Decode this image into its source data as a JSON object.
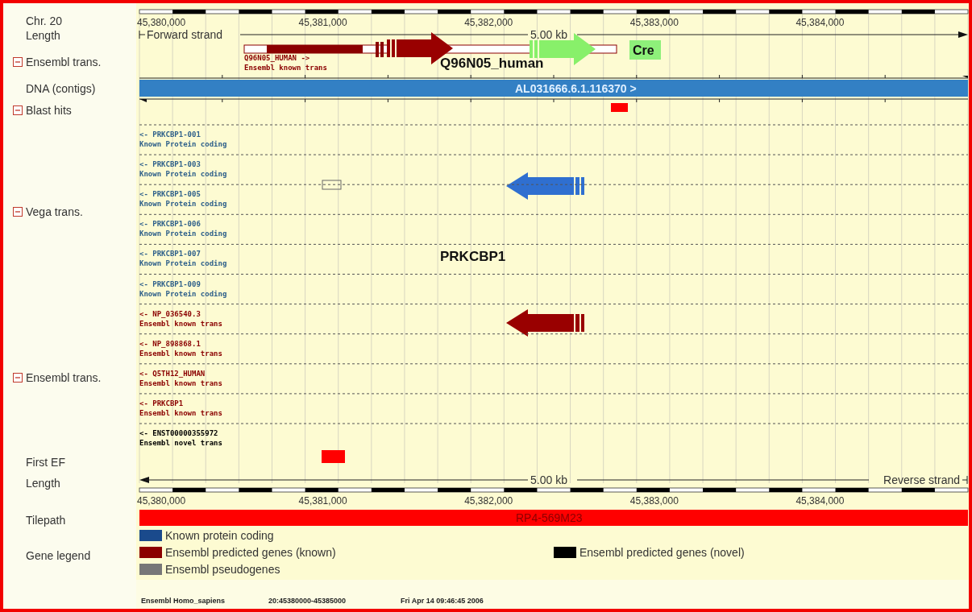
{
  "header": {
    "chromosome": "Chr. 20",
    "length_label": "Length"
  },
  "ruler_top": {
    "ticks": [
      "45,380,000",
      "45,381,000",
      "45,382,000",
      "45,383,000",
      "45,384,000"
    ],
    "strand": "Forward strand",
    "scale": "5.00 kb"
  },
  "ensembl_top": {
    "label": "Ensembl trans.",
    "expanded": true,
    "transcript": {
      "name": "Q96N05_HUMAN ->",
      "type": "Ensembl known trans",
      "color": "#8b0000"
    }
  },
  "dna": {
    "label": "DNA (contigs)",
    "contig": "AL031666.6.1.116370 >"
  },
  "blast": {
    "label": "Blast hits",
    "expanded": true
  },
  "vega": {
    "label": "Vega trans.",
    "expanded": true,
    "transcripts": [
      {
        "name": "<- PRKCBP1-001",
        "type": "Known Protein coding",
        "color": "#2d5f8a"
      },
      {
        "name": "<- PRKCBP1-003",
        "type": "Known Protein coding",
        "color": "#2d5f8a"
      },
      {
        "name": "<- PRKCBP1-005",
        "type": "Known Protein coding",
        "color": "#2d5f8a"
      },
      {
        "name": "<- PRKCBP1-006",
        "type": "Known Protein coding",
        "color": "#2d5f8a"
      },
      {
        "name": "<- PRKCBP1-007",
        "type": "Known Protein coding",
        "color": "#2d5f8a"
      },
      {
        "name": "<- PRKCBP1-009",
        "type": "Known Protein coding",
        "color": "#2d5f8a"
      }
    ]
  },
  "ensembl": {
    "label": "Ensembl trans.",
    "expanded": true,
    "transcripts": [
      {
        "name": "<- NP_036540.3",
        "type": "Ensembl known trans",
        "color": "#8b0000"
      },
      {
        "name": "<- NP_898868.1",
        "type": "Ensembl known trans",
        "color": "#8b0000"
      },
      {
        "name": "<- Q5TH12_HUMAN",
        "type": "Ensembl known trans",
        "color": "#8b0000"
      },
      {
        "name": "<- PRKCBP1",
        "type": "Ensembl known trans",
        "color": "#8b0000"
      },
      {
        "name": "<- ENST00000355972",
        "type": "Ensembl novel trans",
        "color": "#000000"
      }
    ]
  },
  "first_ef": {
    "label": "First EF"
  },
  "ruler_bottom": {
    "length_label": "Length",
    "scale": "5.00 kb",
    "strand": "Reverse strand",
    "ticks": [
      "45,380,000",
      "45,381,000",
      "45,382,000",
      "45,383,000",
      "45,384,000"
    ]
  },
  "tilepath": {
    "label": "Tilepath",
    "clone": "RP4-569M23"
  },
  "gene_legend": {
    "label": "Gene legend",
    "items": [
      {
        "label": "Known protein coding",
        "color": "#1a4a8c"
      },
      {
        "label": "Ensembl predicted genes (known)",
        "color": "#8b0000"
      },
      {
        "label": "Ensembl pseudogenes",
        "color": "#777777"
      },
      {
        "label": "Ensembl predicted genes (novel)",
        "color": "#000000"
      }
    ]
  },
  "annotations": [
    {
      "kind": "gene",
      "text": "Q96N05_human"
    },
    {
      "kind": "tag",
      "text": "Cre"
    },
    {
      "kind": "gene",
      "text": "PRKCBP1"
    }
  ],
  "footer": [
    "Ensembl Homo_sapiens",
    "20:45380000-45385000",
    "Fri Apr 14 09:46:45 2006"
  ]
}
